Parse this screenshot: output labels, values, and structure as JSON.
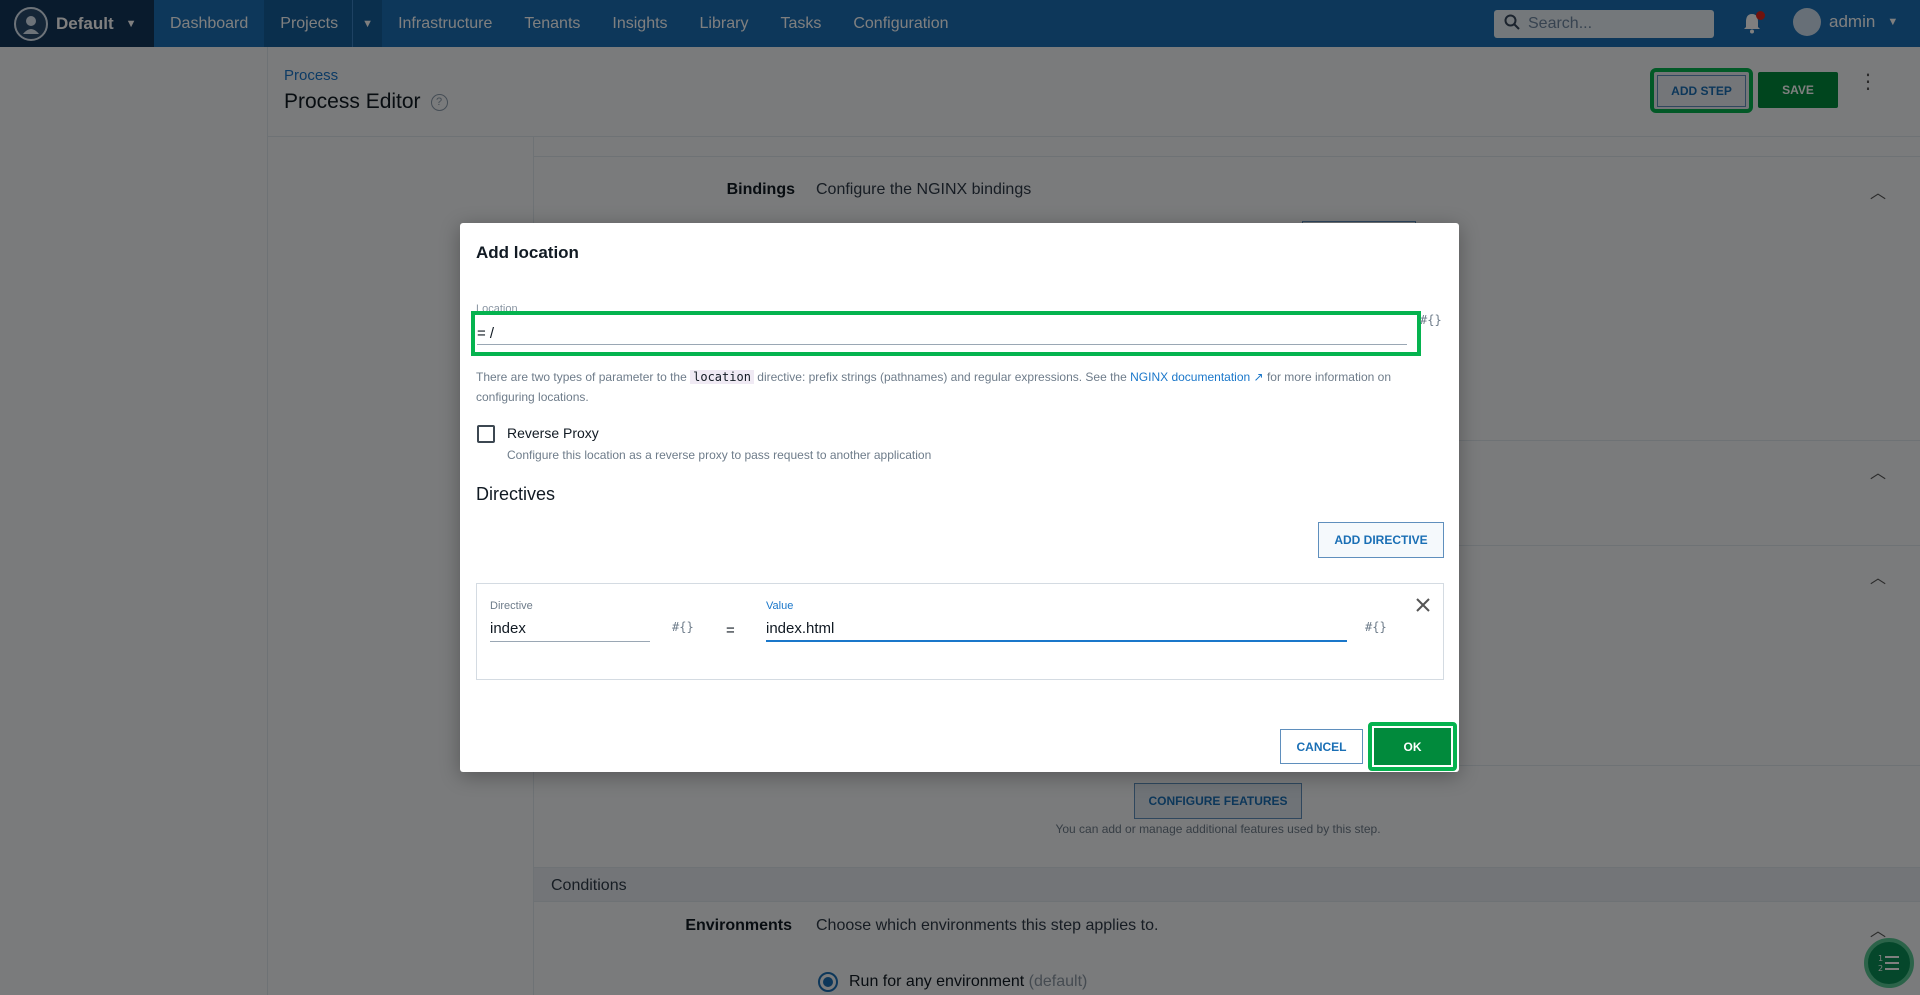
{
  "topnav": {
    "space": "Default",
    "items": [
      "Dashboard",
      "Projects",
      "Infrastructure",
      "Tenants",
      "Insights",
      "Library",
      "Tasks",
      "Configuration"
    ],
    "search_placeholder": "Search...",
    "user": "admin"
  },
  "header": {
    "breadcrumb": "Process",
    "title": "Process Editor",
    "add_step": "ADD STEP",
    "save": "SAVE"
  },
  "content": {
    "bindings_label": "Bindings",
    "bindings_desc": "Configure the NGINX bindings",
    "configure_features": "CONFIGURE FEATURES",
    "features_hint": "You can add or manage additional features used by this step.",
    "conditions": "Conditions",
    "environments_label": "Environments",
    "environments_desc": "Choose which environments this step applies to.",
    "run_any": "Run for any environment",
    "run_any_default": "(default)"
  },
  "dialog": {
    "title": "Add location",
    "location_label": "Location",
    "location_value": "= /",
    "var_icon": "#{}",
    "help_prefix": "There are two types of parameter to the",
    "help_code": "location",
    "help_middle": "directive: prefix strings (pathnames) and regular expressions. See the",
    "help_link": "NGINX documentation",
    "help_suffix": "for more information on configuring locations.",
    "reverse_proxy_label": "Reverse Proxy",
    "reverse_proxy_help": "Configure this location as a reverse proxy to pass request to another application",
    "directives_title": "Directives",
    "add_directive": "ADD DIRECTIVE",
    "directive_label": "Directive",
    "directive_value": "index",
    "equals": "=",
    "value_label": "Value",
    "value_value": "index.html",
    "cancel": "CANCEL",
    "ok": "OK"
  }
}
